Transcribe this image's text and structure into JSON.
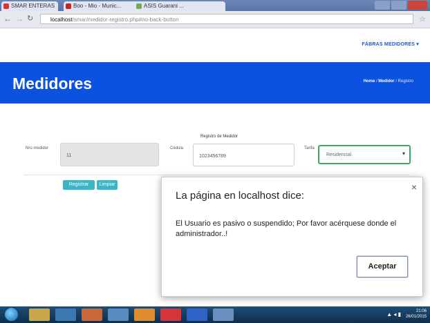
{
  "browser": {
    "tabs": [
      {
        "label": "SMAR ENTERAS"
      },
      {
        "label": "Boo - Mio - Munic..."
      },
      {
        "label": "ASIS Guarani ..."
      }
    ],
    "url_host": "localhost",
    "url_path": "/smar/medidor-registro.php#no-back-button"
  },
  "page": {
    "top_link": "FÁBRAS MEDIDORES",
    "title": "Medidores",
    "breadcrumb": {
      "home": "Home",
      "sep1": "/",
      "current": "Medidor",
      "sep2": "/",
      "last": "Registro"
    }
  },
  "form": {
    "title": "Registro de Medidor",
    "numero_label": "Nro medidor",
    "numero_value": "11",
    "cedula_label": "Cédula",
    "cedula_value": "1023456789",
    "tarifa_label": "Tarifa",
    "tarifa_value": "Residencial",
    "register_label": "Registrar",
    "clear_label": "Limpiar"
  },
  "dialog": {
    "title": "La página en localhost dice:",
    "message": "El Usuario es pasivo o suspendido; Por favor acérquese donde el administrador..!",
    "ok_label": "Aceptar",
    "close_glyph": "×"
  },
  "taskbar": {
    "clock_time": "21:06",
    "clock_date": "26/01/2015"
  },
  "colors": {
    "banner": "#0c52e0",
    "button": "#3bb6c6",
    "select_focus": "#3aa76d"
  }
}
